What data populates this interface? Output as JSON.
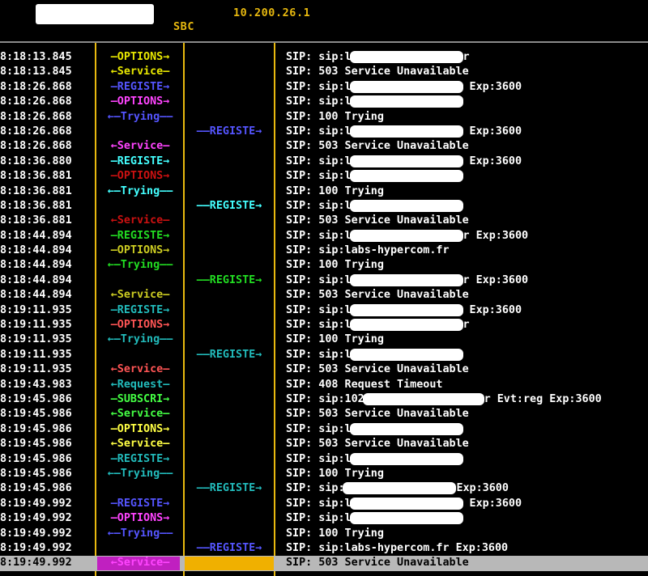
{
  "header": {
    "ip": "10.200.26.1",
    "sbc_label": "SBC"
  },
  "colors": {
    "accent": "#e8b90f",
    "background": "#000000",
    "selection": "#b8b8b8"
  },
  "rows": [
    {
      "time": "8:18:13.845",
      "arrow": "—OPTIONS→",
      "lane": 1,
      "color": "#e8e800",
      "msg": "SIP: sip:l",
      "msg2": "r"
    },
    {
      "time": "8:18:13.845",
      "arrow": "←Service—",
      "lane": 1,
      "color": "#e8e800",
      "msg": "SIP: 503 Service Unavailable"
    },
    {
      "time": "8:18:26.868",
      "arrow": "—REGISTE→",
      "lane": 1,
      "color": "#5555ff",
      "msg": "SIP: sip:l",
      "msg2": " Exp:3600"
    },
    {
      "time": "8:18:26.868",
      "arrow": "—OPTIONS→",
      "lane": 1,
      "color": "#ff44ff",
      "msg": "SIP: sip:l",
      "msg2": ""
    },
    {
      "time": "8:18:26.868",
      "arrow": "←—Trying——",
      "lane": 1,
      "color": "#5555ff",
      "msg": "SIP: 100 Trying"
    },
    {
      "time": "8:18:26.868",
      "arrow": "——REGISTE→",
      "lane": 2,
      "color": "#5555ff",
      "msg": "SIP: sip:l",
      "msg2": " Exp:3600"
    },
    {
      "time": "8:18:26.868",
      "arrow": "←Service—",
      "lane": 1,
      "color": "#ff44ff",
      "msg": "SIP: 503 Service Unavailable"
    },
    {
      "time": "8:18:36.880",
      "arrow": "—REGISTE→",
      "lane": 1,
      "color": "#44ffff",
      "msg": "SIP: sip:l",
      "msg2": " Exp:3600"
    },
    {
      "time": "8:18:36.881",
      "arrow": "—OPTIONS→",
      "lane": 1,
      "color": "#cc1111",
      "msg": "SIP: sip:l",
      "msg2": ""
    },
    {
      "time": "8:18:36.881",
      "arrow": "←—Trying——",
      "lane": 1,
      "color": "#44ffff",
      "msg": "SIP: 100 Trying"
    },
    {
      "time": "8:18:36.881",
      "arrow": "——REGISTE→",
      "lane": 2,
      "color": "#44ffff",
      "msg": "SIP: sip:l",
      "msg2": ""
    },
    {
      "time": "8:18:36.881",
      "arrow": "←Service—",
      "lane": 1,
      "color": "#cc1111",
      "msg": "SIP: 503 Service Unavailable"
    },
    {
      "time": "8:18:44.894",
      "arrow": "—REGISTE→",
      "lane": 1,
      "color": "#22dd22",
      "msg": "SIP: sip:l",
      "msg2": "r Exp:3600"
    },
    {
      "time": "8:18:44.894",
      "arrow": "—OPTIONS→",
      "lane": 1,
      "color": "#cccc22",
      "msg": "SIP: sip:labs-hypercom.fr"
    },
    {
      "time": "8:18:44.894",
      "arrow": "←—Trying——",
      "lane": 1,
      "color": "#22dd22",
      "msg": "SIP: 100 Trying"
    },
    {
      "time": "8:18:44.894",
      "arrow": "——REGISTE→",
      "lane": 2,
      "color": "#22dd22",
      "msg": "SIP: sip:l",
      "msg2": "r Exp:3600"
    },
    {
      "time": "8:18:44.894",
      "arrow": "←Service—",
      "lane": 1,
      "color": "#cccc22",
      "msg": "SIP: 503 Service Unavailable"
    },
    {
      "time": "8:19:11.935",
      "arrow": "—REGISTE→",
      "lane": 1,
      "color": "#22bbbb",
      "msg": "SIP: sip:l",
      "msg2": " Exp:3600"
    },
    {
      "time": "8:19:11.935",
      "arrow": "—OPTIONS→",
      "lane": 1,
      "color": "#ff5555",
      "msg": "SIP: sip:l",
      "msg2": "r"
    },
    {
      "time": "8:19:11.935",
      "arrow": "←—Trying——",
      "lane": 1,
      "color": "#22bbbb",
      "msg": "SIP: 100 Trying"
    },
    {
      "time": "8:19:11.935",
      "arrow": "——REGISTE→",
      "lane": 2,
      "color": "#22bbbb",
      "msg": "SIP: sip:l",
      "msg2": ""
    },
    {
      "time": "8:19:11.935",
      "arrow": "←Service—",
      "lane": 1,
      "color": "#ff5555",
      "msg": "SIP: 503 Service Unavailable"
    },
    {
      "time": "8:19:43.983",
      "arrow": "←Request—",
      "lane": 1,
      "color": "#22bbbb",
      "msg": "SIP: 408 Request Timeout"
    },
    {
      "time": "8:19:45.986",
      "arrow": "—SUBSCRI→",
      "lane": 1,
      "color": "#44ff44",
      "msg": "SIP: sip:102",
      "msg2": "r Evt:reg Exp:3600"
    },
    {
      "time": "8:19:45.986",
      "arrow": "←Service—",
      "lane": 1,
      "color": "#44ff44",
      "msg": "SIP: 503 Service Unavailable"
    },
    {
      "time": "8:19:45.986",
      "arrow": "—OPTIONS→",
      "lane": 1,
      "color": "#ffff44",
      "msg": "SIP: sip:l",
      "msg2": ""
    },
    {
      "time": "8:19:45.986",
      "arrow": "←Service—",
      "lane": 1,
      "color": "#ffff44",
      "msg": "SIP: 503 Service Unavailable"
    },
    {
      "time": "8:19:45.986",
      "arrow": "—REGISTE→",
      "lane": 1,
      "color": "#22bbbb",
      "msg": "SIP: sip:l",
      "msg2": ""
    },
    {
      "time": "8:19:45.986",
      "arrow": "←—Trying——",
      "lane": 1,
      "color": "#22bbbb",
      "msg": "SIP: 100 Trying"
    },
    {
      "time": "8:19:45.986",
      "arrow": "——REGISTE→",
      "lane": 2,
      "color": "#22bbbb",
      "msg": "SIP: sip:",
      "msg2": "Exp:3600"
    },
    {
      "time": "8:19:49.992",
      "arrow": "—REGISTE→",
      "lane": 1,
      "color": "#5555ff",
      "msg": "SIP: sip:l",
      "msg2": " Exp:3600"
    },
    {
      "time": "8:19:49.992",
      "arrow": "—OPTIONS→",
      "lane": 1,
      "color": "#ff44ff",
      "msg": "SIP: sip:l",
      "msg2": ""
    },
    {
      "time": "8:19:49.992",
      "arrow": "←—Trying——",
      "lane": 1,
      "color": "#5555ff",
      "msg": "SIP: 100 Trying"
    },
    {
      "time": "8:19:49.992",
      "arrow": "——REGISTE→",
      "lane": 2,
      "color": "#5555ff",
      "msg": "SIP: sip:labs-hypercom.fr Exp:3600"
    },
    {
      "time": "8:19:49.992",
      "arrow": "←Service—",
      "lane": 1,
      "color": "#ff44ff",
      "msg": "SIP: 503 Service Unavailable",
      "selected": true
    }
  ]
}
